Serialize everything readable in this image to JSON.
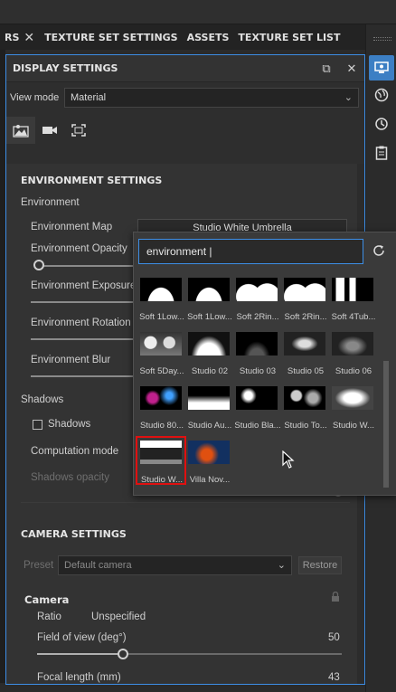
{
  "tabs": {
    "first_partial": "RS",
    "items": [
      "TEXTURE SET SETTINGS",
      "ASSETS",
      "TEXTURE SET LIST"
    ]
  },
  "panel": {
    "title": "DISPLAY SETTINGS",
    "view_mode_label": "View mode",
    "view_mode_value": "Material",
    "icon_tabs": [
      "environment-tab",
      "camera-tab",
      "viewport-tab"
    ]
  },
  "environment": {
    "section_title": "ENVIRONMENT SETTINGS",
    "group_label": "Environment",
    "map_label": "Environment Map",
    "map_value": "Studio White Umbrella",
    "opacity_label": "Environment Opacity",
    "exposure_label": "Environment Exposure",
    "rotation_label": "Environment Rotation",
    "blur_label": "Environment Blur"
  },
  "shadows": {
    "group_label": "Shadows",
    "checkbox_label": "Shadows",
    "computation_label": "Computation mode",
    "opacity_label": "Shadows opacity"
  },
  "camera": {
    "section_title": "CAMERA SETTINGS",
    "preset_label": "Preset",
    "preset_value": "Default camera",
    "restore_label": "Restore",
    "group_label": "Camera",
    "ratio_label": "Ratio",
    "ratio_value": "Unspecified",
    "fov_label": "Field of view (deg°)",
    "fov_value": "50",
    "focal_partial": "Focal length (mm)",
    "focal_value": "43"
  },
  "popup": {
    "search_value": "environment |",
    "items": [
      {
        "caption": "Soft 1Low..."
      },
      {
        "caption": "Soft 1Low..."
      },
      {
        "caption": "Soft 2Rin..."
      },
      {
        "caption": "Soft 2Rin..."
      },
      {
        "caption": "Soft 4Tub..."
      },
      {
        "caption": "Soft 5Day..."
      },
      {
        "caption": "Studio 02"
      },
      {
        "caption": "Studio 03"
      },
      {
        "caption": "Studio 05"
      },
      {
        "caption": "Studio 06"
      },
      {
        "caption": "Studio 80..."
      },
      {
        "caption": "Studio Au..."
      },
      {
        "caption": "Studio Bla..."
      },
      {
        "caption": "Studio To..."
      },
      {
        "caption": "Studio W..."
      },
      {
        "caption": "Studio W..."
      },
      {
        "caption": "Villa Nov..."
      }
    ],
    "selected_index": 15
  },
  "colors": {
    "accent": "#3d8ee6",
    "selection": "#e01010"
  }
}
